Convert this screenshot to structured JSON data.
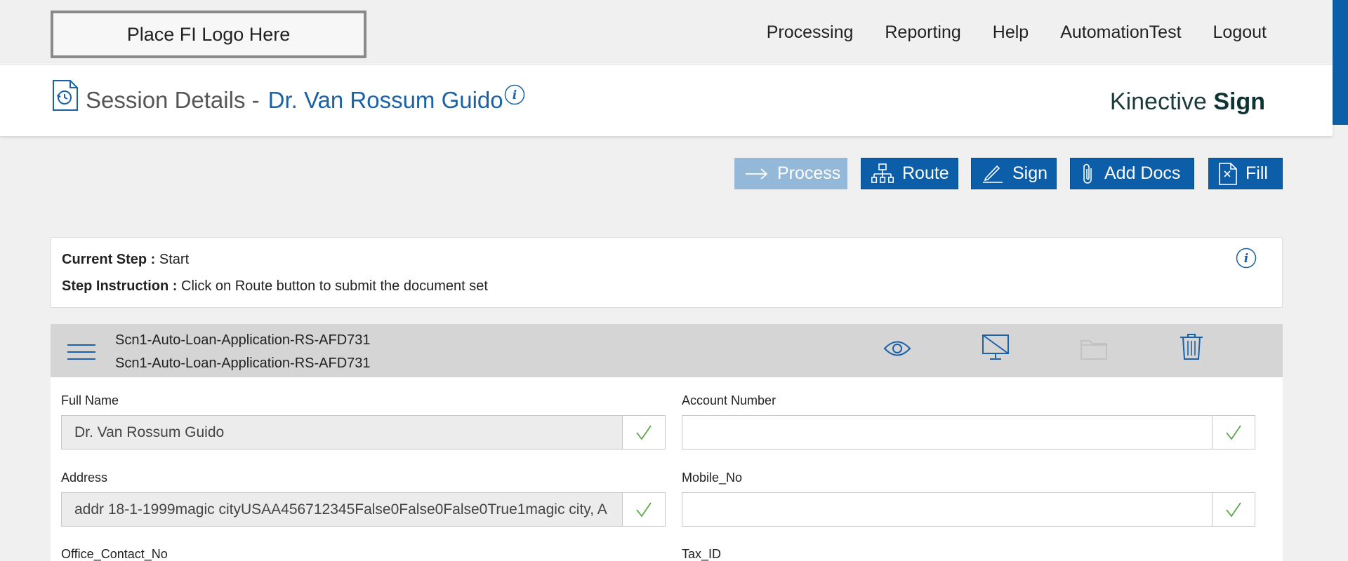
{
  "logo": {
    "text": "Place FI Logo Here"
  },
  "nav": {
    "items": [
      "Processing",
      "Reporting",
      "Help",
      "AutomationTest",
      "Logout"
    ]
  },
  "header": {
    "title_prefix": "Session Details -",
    "title_name": "Dr. Van Rossum Guido",
    "brand_light": "Kinective",
    "brand_bold": "Sign"
  },
  "toolbar": {
    "process_label": "Process",
    "route_label": "Route",
    "sign_label": "Sign",
    "add_docs_label": "Add Docs",
    "fill_label": "Fill"
  },
  "step": {
    "current_label": "Current Step :",
    "current_value": "Start",
    "instruction_label": "Step Instruction :",
    "instruction_value": "Click on Route button to submit the document set"
  },
  "document": {
    "name_line1": "Scn1-Auto-Loan-Application-RS-AFD731",
    "name_line2": "Scn1-Auto-Loan-Application-RS-AFD731"
  },
  "form": {
    "full_name_label": "Full Name",
    "full_name_value": "Dr. Van Rossum Guido",
    "account_number_label": "Account Number",
    "account_number_value": "",
    "address_label": "Address",
    "address_value": "addr 18-1-1999magic cityUSAA456712345False0False0False0True1magic city, A",
    "mobile_label": "Mobile_No",
    "mobile_value": "",
    "office_contact_label": "Office_Contact_No",
    "tax_id_label": "Tax_ID"
  },
  "colors": {
    "primary": "#0d5ea8",
    "primary_disabled": "#93b8d8",
    "check_green": "#5aa646"
  }
}
